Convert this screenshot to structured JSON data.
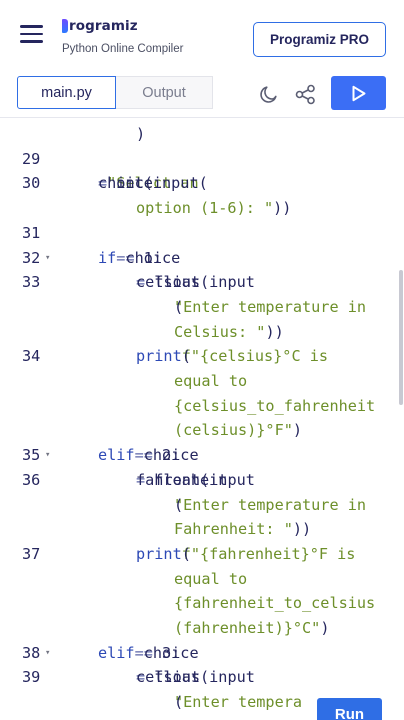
{
  "header": {
    "brand": "rogramiz",
    "subtitle": "Python Online Compiler",
    "pro_button": "Programiz PRO"
  },
  "tabs": {
    "main": "main.py",
    "output": "Output"
  },
  "icons": {
    "menu": "hamburger-icon",
    "theme": "moon-icon",
    "share": "share-icon",
    "run": "play-icon"
  },
  "colors": {
    "accent": "#2f6ee5",
    "run": "#3b6ef5",
    "text": "#25265e",
    "keyword": "#2d49b5",
    "string": "#6d8f2a"
  },
  "editor": {
    "lines": [
      {
        "num": "",
        "fold": false,
        "segments": [
          {
            "t": ")",
            "c": "code"
          }
        ],
        "indent": 136
      },
      {
        "num": "29",
        "fold": false,
        "segments": [],
        "indent": 98
      },
      {
        "num": "30",
        "fold": false,
        "segments": [
          {
            "t": "choice ",
            "c": "code"
          },
          {
            "t": "=",
            "c": "op"
          },
          {
            "t": " int(input(",
            "c": "code"
          },
          {
            "t": "\"Select an",
            "c": "str"
          }
        ],
        "indent": 98
      },
      {
        "num": "",
        "fold": false,
        "segments": [
          {
            "t": "option (1-6): \"",
            "c": "str"
          },
          {
            "t": "))",
            "c": "code"
          }
        ],
        "indent": 136
      },
      {
        "num": "31",
        "fold": false,
        "segments": [],
        "indent": 98
      },
      {
        "num": "32",
        "fold": true,
        "segments": [
          {
            "t": "if",
            "c": "kw"
          },
          {
            "t": " choice ",
            "c": "code"
          },
          {
            "t": "==",
            "c": "op"
          },
          {
            "t": " 1:",
            "c": "code"
          }
        ],
        "indent": 98
      },
      {
        "num": "33",
        "fold": false,
        "segments": [
          {
            "t": "celsius ",
            "c": "code"
          },
          {
            "t": "=",
            "c": "op"
          },
          {
            "t": " float(input",
            "c": "code"
          }
        ],
        "indent": 136
      },
      {
        "num": "",
        "fold": false,
        "segments": [
          {
            "t": "(",
            "c": "code"
          },
          {
            "t": "\"Enter temperature in",
            "c": "str"
          }
        ],
        "indent": 174
      },
      {
        "num": "",
        "fold": false,
        "segments": [
          {
            "t": "Celsius: \"",
            "c": "str"
          },
          {
            "t": "))",
            "c": "code"
          }
        ],
        "indent": 174
      },
      {
        "num": "34",
        "fold": false,
        "segments": [
          {
            "t": "print",
            "c": "kw"
          },
          {
            "t": "(",
            "c": "code"
          },
          {
            "t": "f\"{celsius}°C is",
            "c": "str"
          }
        ],
        "indent": 136
      },
      {
        "num": "",
        "fold": false,
        "segments": [
          {
            "t": "equal to",
            "c": "str"
          }
        ],
        "indent": 174
      },
      {
        "num": "",
        "fold": false,
        "segments": [
          {
            "t": "{celsius_to_fahrenheit",
            "c": "str"
          }
        ],
        "indent": 174
      },
      {
        "num": "",
        "fold": false,
        "segments": [
          {
            "t": "(celsius)}°F\"",
            "c": "str"
          },
          {
            "t": ")",
            "c": "code"
          }
        ],
        "indent": 174
      },
      {
        "num": "35",
        "fold": true,
        "segments": [
          {
            "t": "elif",
            "c": "kw"
          },
          {
            "t": " choice ",
            "c": "code"
          },
          {
            "t": "==",
            "c": "op"
          },
          {
            "t": " 2:",
            "c": "code"
          }
        ],
        "indent": 98
      },
      {
        "num": "36",
        "fold": false,
        "segments": [
          {
            "t": "fahrenheit ",
            "c": "code"
          },
          {
            "t": "=",
            "c": "op"
          },
          {
            "t": " float(input",
            "c": "code"
          }
        ],
        "indent": 136
      },
      {
        "num": "",
        "fold": false,
        "segments": [
          {
            "t": "(",
            "c": "code"
          },
          {
            "t": "\"Enter temperature in",
            "c": "str"
          }
        ],
        "indent": 174
      },
      {
        "num": "",
        "fold": false,
        "segments": [
          {
            "t": "Fahrenheit: \"",
            "c": "str"
          },
          {
            "t": "))",
            "c": "code"
          }
        ],
        "indent": 174
      },
      {
        "num": "37",
        "fold": false,
        "segments": [
          {
            "t": "print",
            "c": "kw"
          },
          {
            "t": "(",
            "c": "code"
          },
          {
            "t": "f\"{fahrenheit}°F is",
            "c": "str"
          }
        ],
        "indent": 136
      },
      {
        "num": "",
        "fold": false,
        "segments": [
          {
            "t": "equal to",
            "c": "str"
          }
        ],
        "indent": 174
      },
      {
        "num": "",
        "fold": false,
        "segments": [
          {
            "t": "{fahrenheit_to_celsius",
            "c": "str"
          }
        ],
        "indent": 174
      },
      {
        "num": "",
        "fold": false,
        "segments": [
          {
            "t": "(fahrenheit)}°C\"",
            "c": "str"
          },
          {
            "t": ")",
            "c": "code"
          }
        ],
        "indent": 174
      },
      {
        "num": "38",
        "fold": true,
        "segments": [
          {
            "t": "elif",
            "c": "kw"
          },
          {
            "t": " choice ",
            "c": "code"
          },
          {
            "t": "==",
            "c": "op"
          },
          {
            "t": " 3:",
            "c": "code"
          }
        ],
        "indent": 98
      },
      {
        "num": "39",
        "fold": false,
        "segments": [
          {
            "t": "celsius ",
            "c": "code"
          },
          {
            "t": "=",
            "c": "op"
          },
          {
            "t": " float(input",
            "c": "code"
          }
        ],
        "indent": 136
      },
      {
        "num": "",
        "fold": false,
        "segments": [
          {
            "t": "(",
            "c": "code"
          },
          {
            "t": "\"Enter tempera",
            "c": "str"
          }
        ],
        "indent": 174
      }
    ]
  },
  "run_button": "Run"
}
